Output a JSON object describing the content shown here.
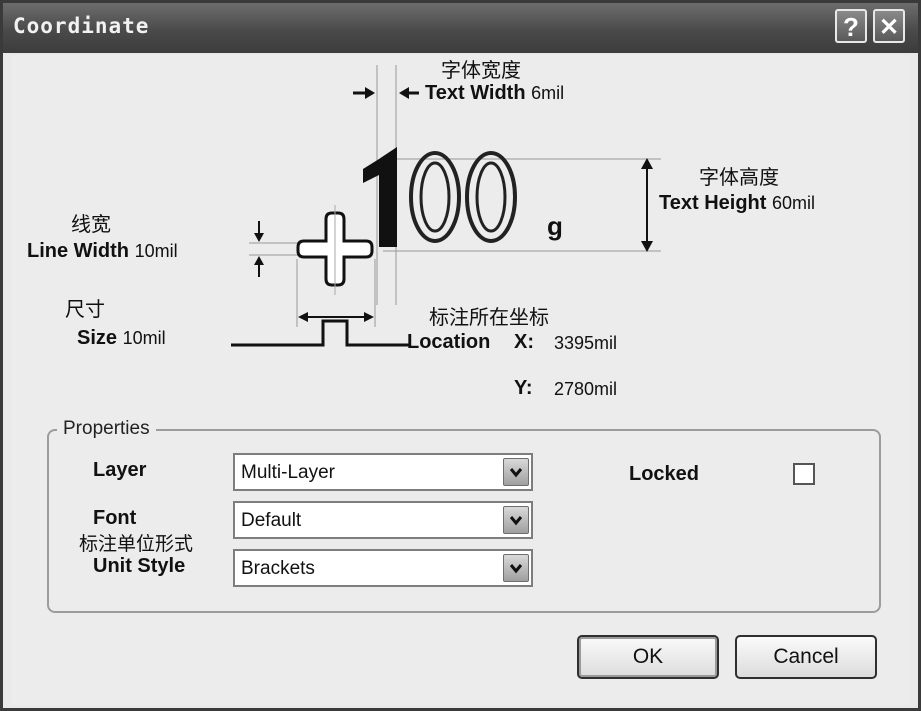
{
  "window": {
    "title": "Coordinate",
    "help_glyph": "?",
    "close_glyph": "✕"
  },
  "diagram": {
    "sample_text": "100",
    "sample_unit": "g",
    "text_width": {
      "cn": "字体宽度",
      "label": "Text Width",
      "value": "6mil"
    },
    "text_height": {
      "cn": "字体高度",
      "label": "Text Height",
      "value": "60mil"
    },
    "line_width": {
      "cn": "线宽",
      "label": "Line Width",
      "value": "10mil"
    },
    "size": {
      "cn": "尺寸",
      "label": "Size",
      "value": "10mil"
    },
    "location": {
      "cn": "标注所在坐标",
      "label": "Location",
      "x_label": "X:",
      "x_value": "3395mil",
      "y_label": "Y:",
      "y_value": "2780mil"
    }
  },
  "properties": {
    "legend": "Properties",
    "layer": {
      "label": "Layer",
      "value": "Multi-Layer"
    },
    "font": {
      "label": "Font",
      "value": "Default"
    },
    "unit_style": {
      "cn": "标注单位形式",
      "label": "Unit Style",
      "value": "Brackets"
    },
    "locked": {
      "label": "Locked",
      "checked": false
    }
  },
  "buttons": {
    "ok": "OK",
    "cancel": "Cancel"
  },
  "colors": {
    "titlebar": "#4a4a4a",
    "face": "#ececec",
    "accent": "#111111"
  }
}
